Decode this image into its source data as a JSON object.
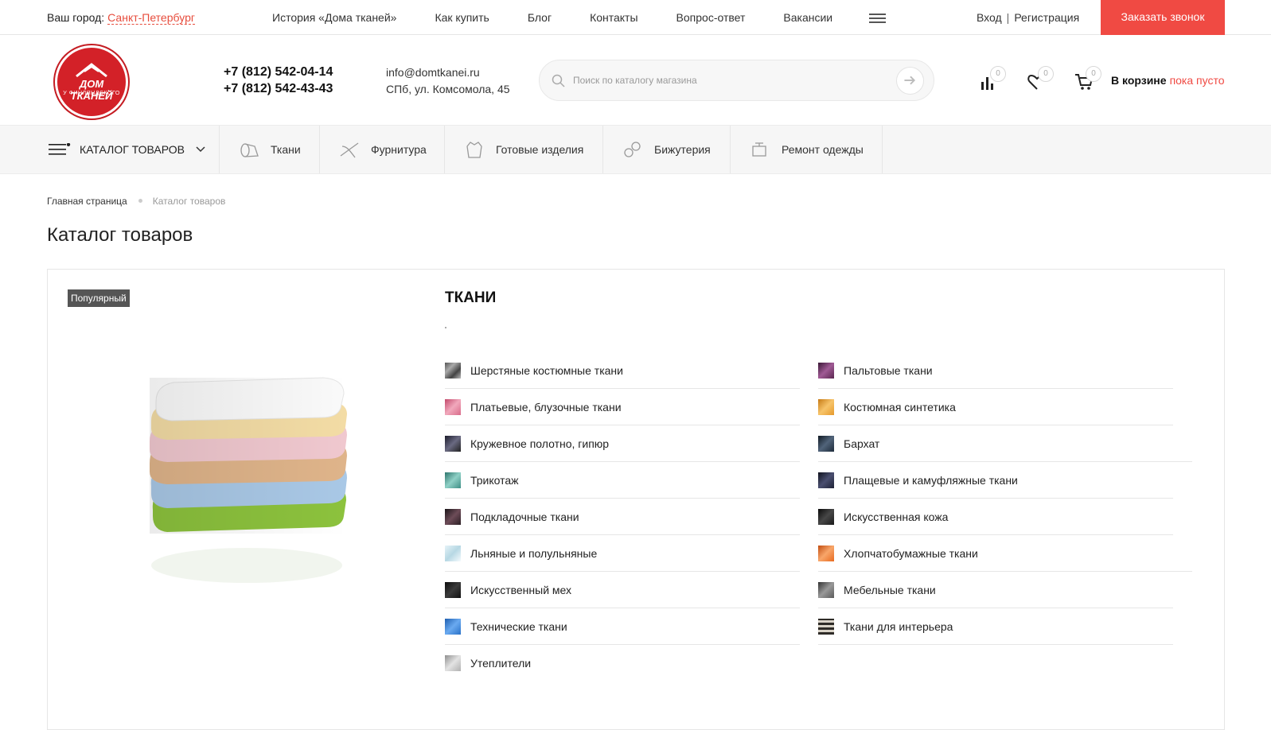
{
  "topbar": {
    "city_label": "Ваш город:",
    "city_value": "Санкт-Петербург",
    "nav": [
      "История «Дома тканей»",
      "Как купить",
      "Блог",
      "Контакты",
      "Вопрос-ответ",
      "Вакансии"
    ],
    "login": "Вход",
    "separator": "|",
    "register": "Регистрация",
    "call_button": "Заказать звонок"
  },
  "header": {
    "logo_line1": "ДОМ ТКАНЕЙ",
    "logo_line2": "У ФИНЛЯНДСКОГО",
    "phone1": "+7 (812) 542-04-14",
    "phone2": "+7 (812) 542-43-43",
    "email": "info@domtkanei.ru",
    "address": "СПб, ул. Комсомола, 45",
    "search_placeholder": "Поиск по каталогу магазина",
    "compare_count": "0",
    "wishlist_count": "0",
    "cart_count": "0",
    "cart_label": "В корзине",
    "cart_status": "пока пусто"
  },
  "catnav": {
    "catalog_label": "КАТАЛОГ ТОВАРОВ",
    "items": [
      {
        "label": "Ткани",
        "icon": "fabric-roll-icon"
      },
      {
        "label": "Фурнитура",
        "icon": "needle-icon"
      },
      {
        "label": "Готовые изделия",
        "icon": "clothes-icon"
      },
      {
        "label": "Бижутерия",
        "icon": "jewelry-icon"
      },
      {
        "label": "Ремонт одежды",
        "icon": "sewing-machine-icon"
      }
    ]
  },
  "breadcrumb": {
    "home": "Главная страница",
    "current": "Каталог товаров"
  },
  "page_title": "Каталог товаров",
  "section": {
    "badge": "Популярный",
    "title": "ТКАНИ",
    "left": [
      {
        "label": "Шерстяные костюмные ткани",
        "color": "#6d6a6a"
      },
      {
        "label": "Платьевые, блузочные ткани",
        "color": "#d86b8a"
      },
      {
        "label": "Кружевное полотно, гипюр",
        "color": "#2a2a3a"
      },
      {
        "label": "Трикотаж",
        "color": "#3f8f86"
      },
      {
        "label": "Подкладочные ткани",
        "color": "#2b1f25"
      },
      {
        "label": "Льняные и полульняные",
        "color": "#cfe6ee"
      },
      {
        "label": "Искусственный мех",
        "color": "#1a1a1a"
      },
      {
        "label": "Технические ткани",
        "color": "#2a72c8"
      },
      {
        "label": "Утеплители",
        "color": "#b0b0b0"
      }
    ],
    "right": [
      {
        "label": "Пальтовые ткани",
        "color": "#5b2750"
      },
      {
        "label": "Костюмная синтетика",
        "color": "#e59a2c"
      },
      {
        "label": "Бархат",
        "color": "#1d2b3a"
      },
      {
        "label": "Плащевые и камуфляжные ткани",
        "color": "#1e2235"
      },
      {
        "label": "Искусственная кожа",
        "color": "#1a1a1a"
      },
      {
        "label": "Хлопчатобумажные ткани",
        "color": "#e86a1f"
      },
      {
        "label": "Мебельные ткани",
        "color": "#5a5a5a"
      },
      {
        "label": "Ткани для интерьера",
        "color": "#4a4640"
      }
    ]
  },
  "colors": {
    "accent": "#f04a43",
    "logo_red": "#d32128"
  }
}
